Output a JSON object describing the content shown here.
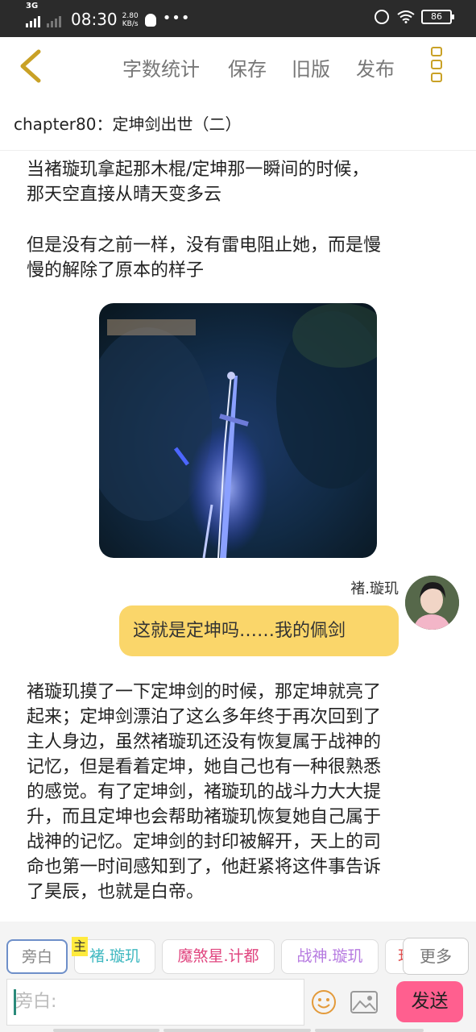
{
  "status_bar": {
    "network": "3G",
    "time": "08:30",
    "speed_value": "2.80",
    "speed_unit": "KB/s",
    "more": "•••",
    "battery": "86"
  },
  "toolbar": {
    "word_count": "字数统计",
    "save": "保存",
    "old_version": "旧版",
    "publish": "发布"
  },
  "chapter_title": "chapter80：定坤剑出世（二）",
  "content": {
    "para1": [
      "当褚璇玑拿起那木棍/定坤那一瞬间的时候，",
      "那天空直接从晴天变多云"
    ],
    "para2": [
      "但是没有之前一样，没有雷电阻止她，而是慢",
      "慢的解除了原本的样子"
    ],
    "speaker": "褚.璇玑",
    "dialogue": "这就是定坤吗……我的佩剑",
    "para3": [
      "褚璇玑摸了一下定坤剑的时候，那定坤就亮了",
      "起来；定坤剑漂泊了这么多年终于再次回到了",
      "主人身边，虽然褚璇玑还没有恢复属于战神的",
      "记忆，但是看着定坤，她自己也有一种很熟悉",
      "的感觉。有了定坤剑，褚璇玑的战斗力大大提",
      "升，而且定坤也会帮助褚璇玑恢复她自己属于",
      "战神的记忆。定坤剑的封印被解开，天上的司",
      "命也第一时间感知到了，他赶紧将这件事告诉",
      "了昊辰，也就是白帝。"
    ]
  },
  "roles": {
    "narrator": "旁白",
    "main_badge": "主",
    "role1": "褚.璇玑",
    "role2": "魔煞星.计都",
    "role3": "战神.璇玑",
    "role4": "玑",
    "more": "更多",
    "colors": {
      "role1": "#3fb8c0",
      "role2": "#e0457f",
      "role3": "#b67ae0",
      "role4": "#e05050"
    }
  },
  "composer": {
    "placeholder": "旁白:",
    "send": "发送"
  }
}
